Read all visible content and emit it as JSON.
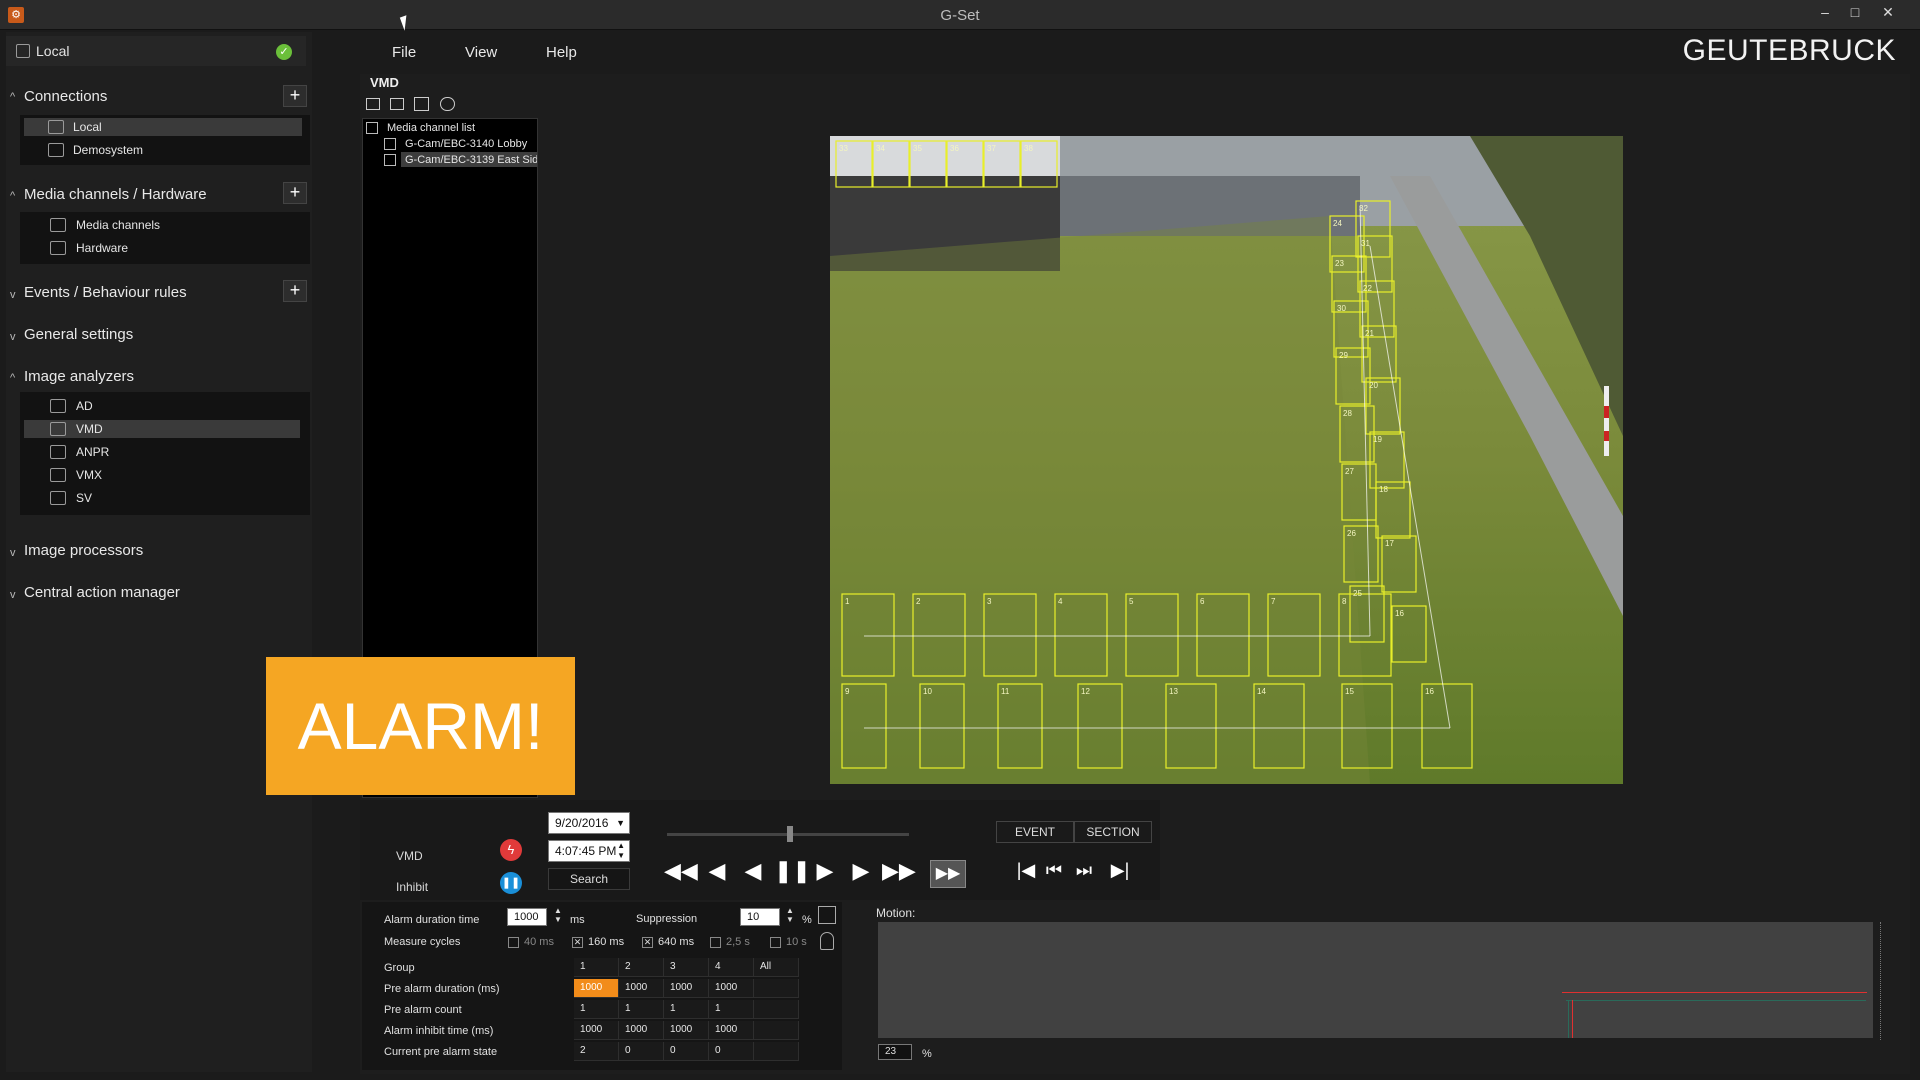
{
  "window": {
    "title": "G-Set",
    "app_icon": "gset-app-icon"
  },
  "brand": "GEUTEBRUCK",
  "sidebar": {
    "local_label": "Local",
    "sections": {
      "connections": "Connections",
      "media": "Media channels / Hardware",
      "events": "Events / Behaviour rules",
      "general": "General settings",
      "analyzers": "Image analyzers",
      "processors": "Image processors",
      "central": "Central action manager"
    },
    "connections_items": [
      "Local",
      "Demosystem"
    ],
    "media_items": [
      "Media channels",
      "Hardware"
    ],
    "analyzer_items": [
      "AD",
      "VMD",
      "ANPR",
      "VMX",
      "SV"
    ],
    "selected_analyzer": "VMD"
  },
  "menu": {
    "file": "File",
    "view": "View",
    "help": "Help"
  },
  "panel": {
    "title": "VMD",
    "tree_root": "Media channel list",
    "tree_items": [
      "G-Cam/EBC-3140 Lobby",
      "G-Cam/EBC-3139 East Side"
    ]
  },
  "video": {
    "top_zones": [
      "33",
      "34",
      "35",
      "36",
      "37",
      "38"
    ],
    "right_zones": [
      "32",
      "24",
      "31",
      "23",
      "22",
      "30",
      "21",
      "29",
      "20",
      "28",
      "19",
      "27",
      "18",
      "26",
      "17",
      "25",
      "16"
    ],
    "bottom_row1": [
      "1",
      "2",
      "3",
      "4",
      "5",
      "6",
      "7",
      "8"
    ],
    "bottom_row2": [
      "9",
      "10",
      "11",
      "12",
      "13",
      "14",
      "15",
      "16"
    ]
  },
  "alarm": {
    "text": "ALARM!",
    "color": "#f5a623"
  },
  "controls": {
    "vmd_label": "VMD",
    "inhibit_label": "Inhibit",
    "date": "9/20/2016",
    "time": "4:07:45 PM",
    "search": "Search",
    "event_tab": "EVENT",
    "section_tab": "SECTION"
  },
  "settings": {
    "alarm_duration_label": "Alarm duration time",
    "alarm_duration_value": "1000",
    "alarm_duration_unit": "ms",
    "suppression_label": "Suppression",
    "suppression_value": "10",
    "suppression_unit": "%",
    "measure_cycles_label": "Measure cycles",
    "cycles": [
      {
        "label": "40 ms",
        "checked": false
      },
      {
        "label": "160 ms",
        "checked": true
      },
      {
        "label": "640 ms",
        "checked": true
      },
      {
        "label": "2,5 s",
        "checked": false
      },
      {
        "label": "10 s",
        "checked": false
      }
    ],
    "table": {
      "headers": [
        "Group",
        "1",
        "2",
        "3",
        "4",
        "All"
      ],
      "rows": [
        {
          "label": "Pre alarm duration (ms)",
          "values": [
            "1000",
            "1000",
            "1000",
            "1000",
            ""
          ]
        },
        {
          "label": "Pre alarm count",
          "values": [
            "1",
            "1",
            "1",
            "1",
            ""
          ]
        },
        {
          "label": "Alarm inhibit time (ms)",
          "values": [
            "1000",
            "1000",
            "1000",
            "1000",
            ""
          ]
        },
        {
          "label": "Current pre alarm state",
          "values": [
            "2",
            "0",
            "0",
            "0",
            ""
          ]
        }
      ]
    }
  },
  "motion": {
    "label": "Motion:",
    "value": "23",
    "unit": "%"
  }
}
